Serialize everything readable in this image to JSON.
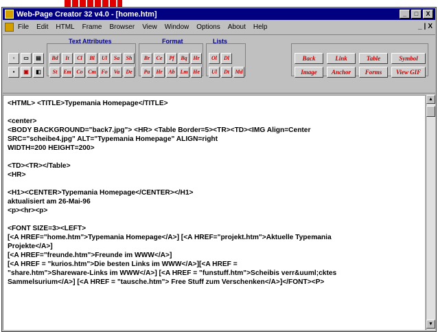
{
  "window": {
    "title": "Web-Page Creator 32 v4.0 - [home.htm]",
    "controls": [
      "_",
      "□",
      "X"
    ],
    "mdi_controls": [
      "_",
      "|",
      "X"
    ]
  },
  "menu": {
    "items": [
      "File",
      "Edit",
      "HTML",
      "Frame",
      "Browser",
      "View",
      "Window",
      "Options",
      "About",
      "Help"
    ]
  },
  "toolbar": {
    "groups": {
      "text_attributes": "Text Attributes",
      "format": "Format",
      "lists": "Lists"
    },
    "file_buttons": [
      "new-file",
      "open-file",
      "print",
      "save",
      "image-file",
      "exit"
    ],
    "text_attr_row1": [
      "Bd",
      "It",
      "Cl",
      "Bl",
      "Ul",
      "Sa",
      "Sh"
    ],
    "text_attr_row2": [
      "St",
      "Em",
      "Co",
      "Cm",
      "Fo",
      "Va",
      "De"
    ],
    "format_row1": [
      "Br",
      "Ce",
      "Pf",
      "Bq",
      "Hr"
    ],
    "format_row2": [
      "Pa",
      "Hr",
      "Ab",
      "Lm",
      "He"
    ],
    "lists_row1": [
      "Ol",
      "Dl"
    ],
    "lists_row2": [
      "Ul",
      "Dt",
      "Md"
    ],
    "link_row1": [
      "Back",
      "Link",
      "Table",
      "Symbol"
    ],
    "link_row2": [
      "Image",
      "Anchor",
      "Forms",
      "View GIF"
    ]
  },
  "editor": {
    "lines": [
      "<HTML> <TITLE>Typemania Homepage</TITLE>",
      "",
      "<center>",
      "<BODY BACKGROUND=\"back7.jpg\"> <HR> <Table Border=5><TR><TD><IMG  Align=Center",
      "SRC=\"scheibe4.jpg\" ALT=\"Typemania Homepage\" ALIGN=right",
      "WIDTH=200 HEIGHT=200>",
      "",
      "<TD><TR></Table>",
      "<HR>",
      "",
      "<H1><CENTER>Typemania Homepage</CENTER></H1>",
      "aktualisiert am 26-Mai-96",
      "<p><hr><p>",
      "",
      "<FONT SIZE=3><LEFT>",
      " [<A HREF=\"home.htm\">Typemania Homepage</A>] [<A HREF=\"projekt.htm\">Aktuelle Typemania",
      "Projekte</A>]",
      " [<A HREF=\"freunde.htm\">Freunde im WWW</A>]",
      " [<A HREF = \"kurios.htm\">Die besten Links im WWW</A>][<A HREF =",
      "\"share.htm\">Shareware-Links im WWW</A>] [<A HREF = \"funstuff.htm\">Scheibis verr&uuml;cktes",
      "Sammelsurium</A>] [<A HREF = \"tausche.htm\"> Free Stuff zum Verschenken</A>]</FONT><P>"
    ]
  },
  "scrollbar": {
    "up_icon": "▲",
    "down_icon": "▼"
  }
}
